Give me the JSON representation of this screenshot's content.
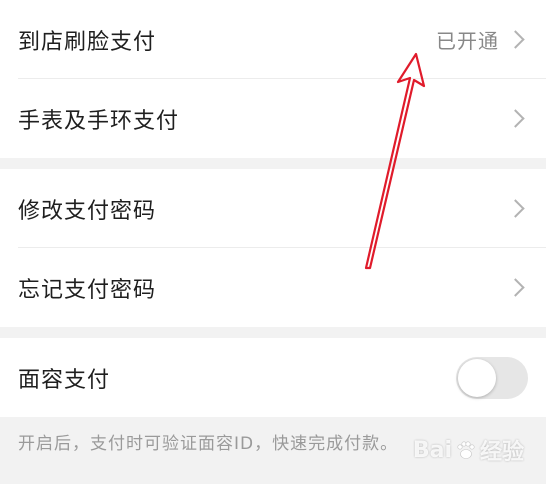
{
  "settings": {
    "rows": [
      {
        "label": "到店刷脸支付",
        "value": "已开通"
      },
      {
        "label": "手表及手环支付"
      },
      {
        "label": "修改支付密码"
      },
      {
        "label": "忘记支付密码"
      }
    ],
    "face_pay": {
      "label": "面容支付",
      "enabled": false
    },
    "hint": "开启后，支付时可验证面容ID，快速完成付款。"
  },
  "watermark": {
    "text": "Bai",
    "icon": "paw-icon",
    "suffix": "经验"
  },
  "colors": {
    "annotation_arrow": "#e01b2b",
    "toggle_off": "#e6e6e6"
  }
}
